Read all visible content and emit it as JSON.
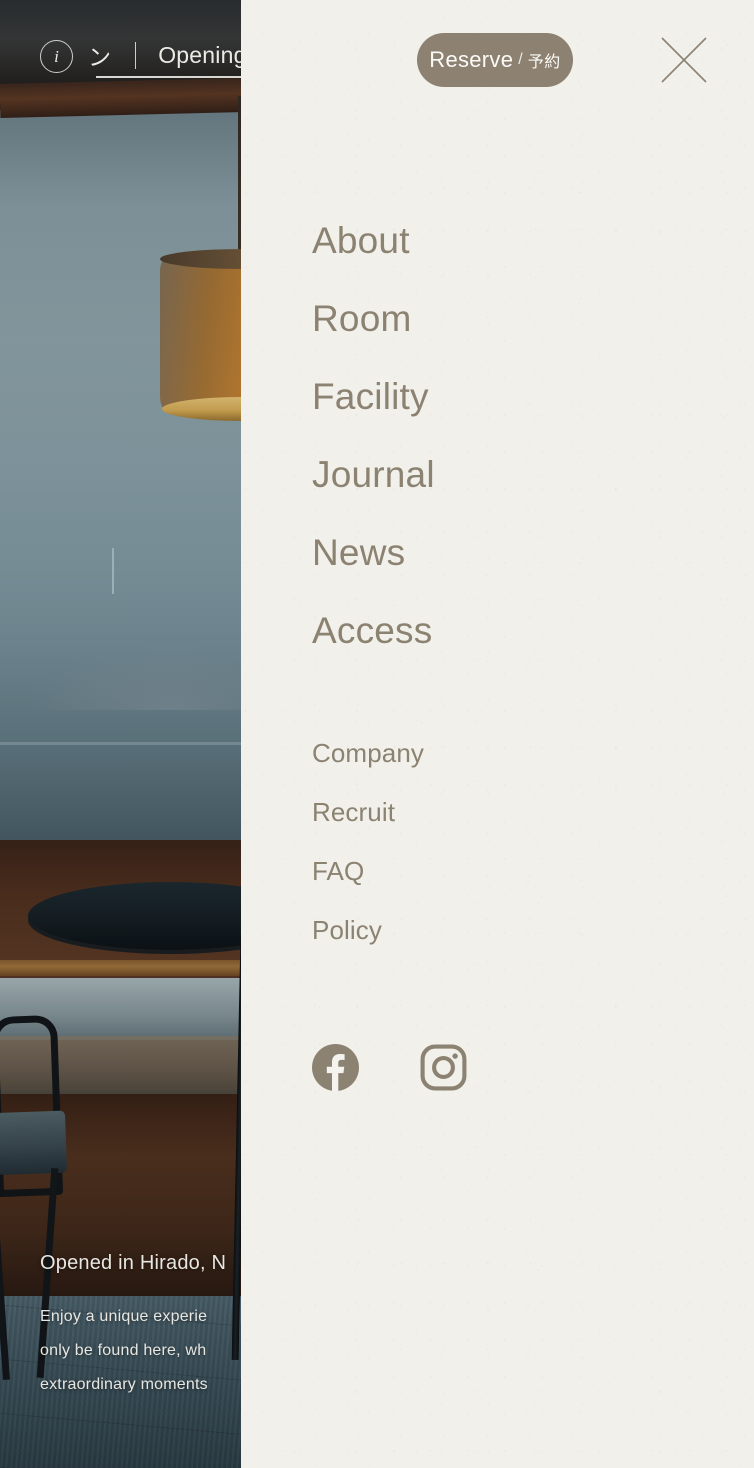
{
  "header_strip": {
    "info_icon": "info-circle-icon",
    "marquee_segment_1": "ン",
    "marquee_separator": "|",
    "marquee_segment_2": "Opening"
  },
  "panel": {
    "reserve_button": {
      "label_en": "Reserve",
      "separator": "/",
      "label_ja": "予約"
    },
    "close_button_icon": "close-icon",
    "primary_nav": [
      {
        "label": "About"
      },
      {
        "label": "Room"
      },
      {
        "label": "Facility"
      },
      {
        "label": "Journal"
      },
      {
        "label": "News"
      },
      {
        "label": "Access"
      }
    ],
    "secondary_nav": [
      {
        "label": "Company"
      },
      {
        "label": "Recruit"
      },
      {
        "label": "FAQ"
      },
      {
        "label": "Policy"
      }
    ],
    "social_links": [
      {
        "name": "facebook-icon"
      },
      {
        "name": "instagram-icon"
      }
    ]
  },
  "caption": {
    "title": "Opened in Hirado, N",
    "line_1": "Enjoy a unique experie",
    "line_2": "only be found here, wh",
    "line_3": "extraordinary moments"
  },
  "colors": {
    "panel_background": "#f1f0eb",
    "nav_text": "#8c8271",
    "reserve_button_background": "#8d8272",
    "reserve_button_text": "#fbfaf7",
    "close_icon": "#8c8271"
  }
}
